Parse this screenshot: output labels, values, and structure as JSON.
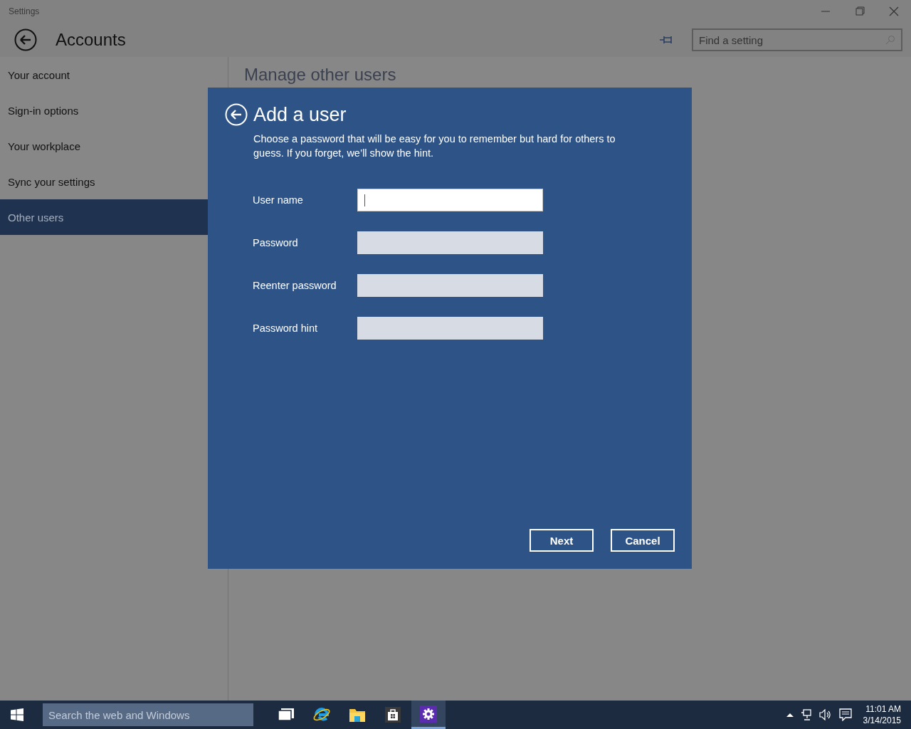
{
  "window": {
    "title": "Settings"
  },
  "header": {
    "title": "Accounts",
    "search": {
      "placeholder": "Find a setting"
    }
  },
  "sidebar": {
    "items": [
      {
        "label": "Your account",
        "selected": false
      },
      {
        "label": "Sign-in options",
        "selected": false
      },
      {
        "label": "Your workplace",
        "selected": false
      },
      {
        "label": "Sync your settings",
        "selected": false
      },
      {
        "label": "Other users",
        "selected": true
      }
    ]
  },
  "content": {
    "heading": "Manage other users"
  },
  "dialog": {
    "title": "Add a user",
    "description": "Choose a password that will be easy for you to remember but hard for others to guess. If you forget, we’ll show the hint.",
    "fields": [
      {
        "label": "User name",
        "focused": true
      },
      {
        "label": "Password",
        "focused": false
      },
      {
        "label": "Reenter password",
        "focused": false
      },
      {
        "label": "Password hint",
        "focused": false
      }
    ],
    "buttons": [
      "Next",
      "Cancel"
    ]
  },
  "taskbar": {
    "search": {
      "placeholder": "Search the web and Windows"
    },
    "apps": [
      {
        "kind": "task-view",
        "selected": false
      },
      {
        "kind": "browser",
        "selected": false
      },
      {
        "kind": "folder",
        "selected": false
      },
      {
        "kind": "store",
        "selected": false
      },
      {
        "kind": "settings",
        "selected": true
      }
    ],
    "clock": {
      "time": "11:01 AM",
      "date": "3/14/2015"
    }
  }
}
